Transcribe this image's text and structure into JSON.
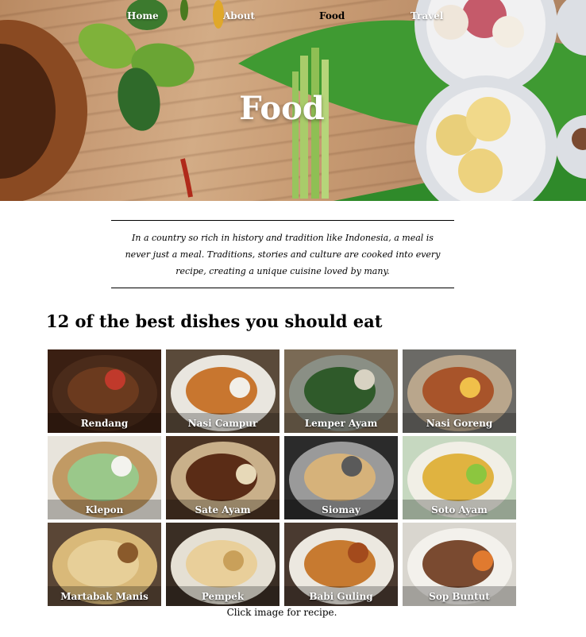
{
  "nav": {
    "items": [
      {
        "label": "Home"
      },
      {
        "label": "About"
      },
      {
        "label": "Food"
      },
      {
        "label": "Travel"
      }
    ],
    "active": "Food"
  },
  "hero": {
    "title": "Food"
  },
  "intro": {
    "text": "In a country so rich in history and tradition like Indonesia, a meal is never just a meal. Traditions, stories and culture are cooked into every recipe, creating a unique cuisine loved by many."
  },
  "section": {
    "title": "12 of the best dishes you should eat"
  },
  "dishes": [
    {
      "name": "Rendang",
      "bg": "#3a1f12",
      "plate": "#4a2b1a",
      "food": "#6b3a1e",
      "accent": "#c0392b"
    },
    {
      "name": "Nasi Campur",
      "bg": "#5a4a3a",
      "plate": "#e9e6df",
      "food": "#c8762f",
      "accent": "#f2efe8"
    },
    {
      "name": "Lemper Ayam",
      "bg": "#7a6a55",
      "plate": "#8a8f85",
      "food": "#2f5a2a",
      "accent": "#d8d2c2"
    },
    {
      "name": "Nasi Goreng",
      "bg": "#6b6a66",
      "plate": "#b9a68c",
      "food": "#a8542a",
      "accent": "#f0c04a"
    },
    {
      "name": "Klepon",
      "bg": "#e8e4dc",
      "plate": "#c19a64",
      "food": "#9ac88a",
      "accent": "#f3f3ee"
    },
    {
      "name": "Sate Ayam",
      "bg": "#4a3323",
      "plate": "#c9b08a",
      "food": "#5a2c16",
      "accent": "#e7d9b8"
    },
    {
      "name": "Siomay",
      "bg": "#2b2b2b",
      "plate": "#9a9a9a",
      "food": "#d6b27a",
      "accent": "#5a5a5a"
    },
    {
      "name": "Soto Ayam",
      "bg": "#c6d8c0",
      "plate": "#f1efe6",
      "food": "#e0b340",
      "accent": "#8cc63f"
    },
    {
      "name": "Martabak Manis",
      "bg": "#5a4636",
      "plate": "#d9b979",
      "food": "#e7cf98",
      "accent": "#8a5a2b"
    },
    {
      "name": "Pempek",
      "bg": "#3a2e24",
      "plate": "#e5e0d4",
      "food": "#e9cf9a",
      "accent": "#c9a05a"
    },
    {
      "name": "Babi Guling",
      "bg": "#4a3a30",
      "plate": "#ece8e0",
      "food": "#c77a30",
      "accent": "#a34a1c"
    },
    {
      "name": "Sop Buntut",
      "bg": "#d9d6cf",
      "plate": "#f3f1ec",
      "food": "#7a4a30",
      "accent": "#e07a2f"
    }
  ],
  "caption": "Click image for recipe.",
  "colors": {
    "nav_active": "#000000",
    "nav_default": "#ffffff"
  }
}
